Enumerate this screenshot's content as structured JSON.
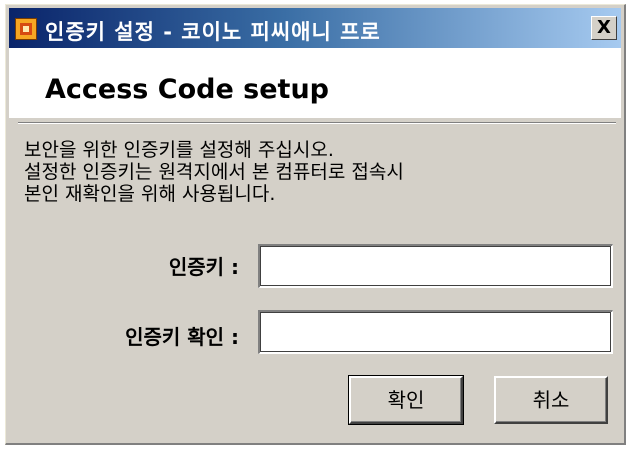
{
  "window": {
    "title": "인증키 설정 - 코이노 피씨애니 프로",
    "close_label": "X",
    "icon": "app-icon"
  },
  "header": {
    "title": "Access Code setup"
  },
  "description": {
    "lines": [
      "보안을 위한 인증키를 설정해 주십시오.",
      "설정한 인증키는 원격지에서 본 컴퓨터로 접속시",
      "본인 재확인을 위해 사용됩니다."
    ]
  },
  "form": {
    "key_label": "인증키 :",
    "key_value": "",
    "confirm_label": "인증키 확인 :",
    "confirm_value": ""
  },
  "buttons": {
    "ok_label": "확인",
    "cancel_label": "취소"
  },
  "colors": {
    "titlebar_start": "#0a246a",
    "titlebar_end": "#a6caf0",
    "dialog_background": "#d4d0c8"
  }
}
